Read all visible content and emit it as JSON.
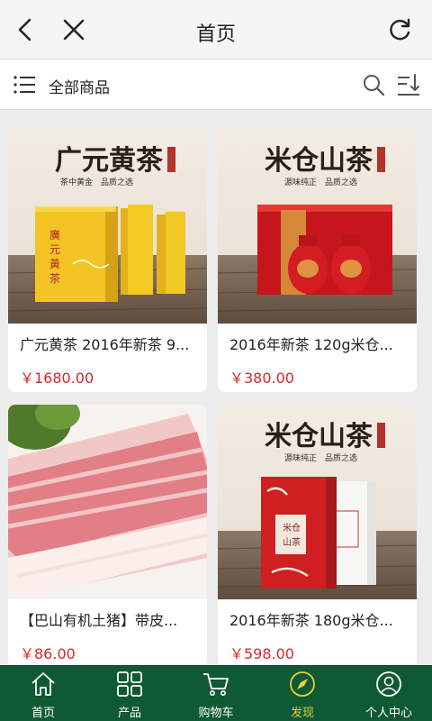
{
  "header": {
    "title": "首页"
  },
  "subbar": {
    "label": "全部商品"
  },
  "products": [
    {
      "name": "广元黄茶 2016年新茶 9...",
      "price": "￥1680.00",
      "image": {
        "banner_title": "广元黄茶",
        "tagline": "茶中黄金　品质之选"
      }
    },
    {
      "name": "2016年新茶 120g米仓...",
      "price": "￥380.00",
      "image": {
        "banner_title": "米仓山茶",
        "tagline": "源味纯正　品质之选"
      }
    },
    {
      "name": "【巴山有机土猪】带皮...",
      "price": "￥86.00"
    },
    {
      "name": "2016年新茶 180g米仓...",
      "price": "￥598.00",
      "image": {
        "banner_title": "米仓山茶",
        "tagline": "源味纯正　品质之选"
      }
    }
  ],
  "tabs": [
    {
      "label": "首页",
      "icon": "home-icon"
    },
    {
      "label": "产品",
      "icon": "grid-icon"
    },
    {
      "label": "购物车",
      "icon": "cart-icon"
    },
    {
      "label": "发现",
      "icon": "compass-icon",
      "active": true
    },
    {
      "label": "个人中心",
      "icon": "user-icon"
    }
  ],
  "colors": {
    "tabbar": "#0f5a35",
    "active_tab": "#e6cf3a",
    "price": "#d7282a"
  }
}
